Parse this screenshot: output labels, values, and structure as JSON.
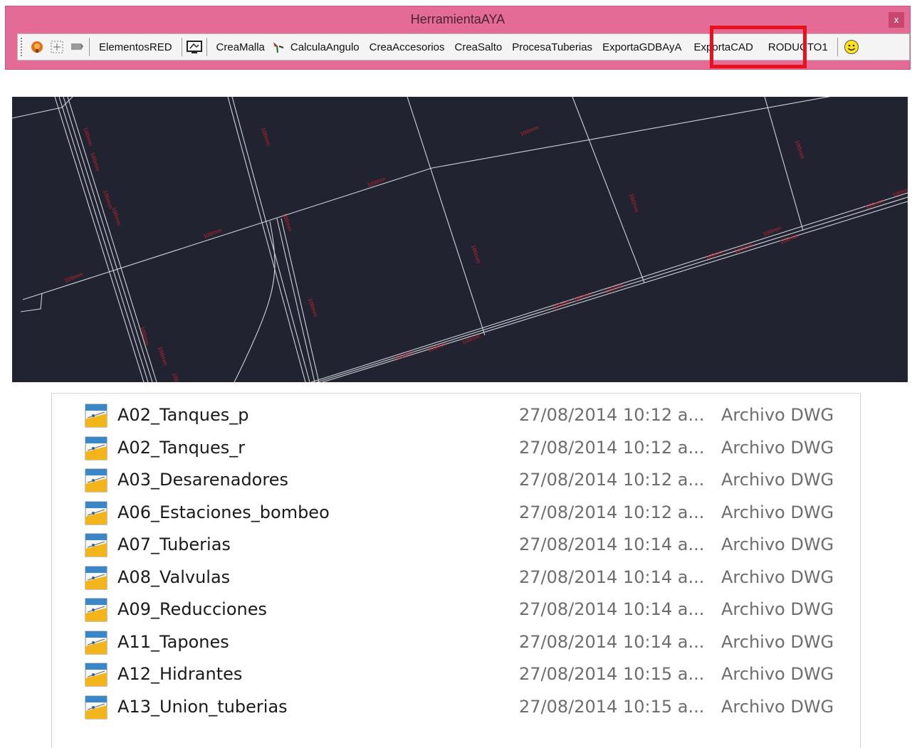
{
  "window": {
    "title": "HerramientaAYA",
    "close_label": "x"
  },
  "toolbar": {
    "items": [
      {
        "label": "ElementosRED"
      },
      {
        "label": "CreaMalla"
      },
      {
        "label": "CalculaAngulo"
      },
      {
        "label": "CreaAccesorios"
      },
      {
        "label": "CreaSalto"
      },
      {
        "label": "ProcesaTuberias"
      },
      {
        "label": "ExportaGDBAyA"
      },
      {
        "label": "ExportaCAD"
      },
      {
        "label": "RODUCTO1"
      }
    ],
    "highlighted": "ExportaCAD",
    "icons": [
      "orange-tool-icon",
      "select-grid-icon",
      "flag-icon",
      "layer-monitor-icon",
      "valve-arrow-icon",
      "smiley-icon"
    ]
  },
  "cad": {
    "labels": [
      "100mm",
      "100mm",
      "100mm",
      "100mm",
      "100mm",
      "100mm",
      "100mm",
      "100mm",
      "100mm",
      "100mm",
      "100mm",
      "100mm",
      "100mm",
      "100mm",
      "100mm",
      "100mm",
      "100mm",
      "100mm",
      "100mm",
      "100mm",
      "100mm",
      "100mm",
      "100mm",
      "100mm",
      "100mm",
      "100mm",
      "100mm",
      "100mm",
      "100mm"
    ]
  },
  "files": [
    {
      "name": "A02_Tanques_p",
      "date": "27/08/2014 10:12 a...",
      "type": "Archivo DWG"
    },
    {
      "name": "A02_Tanques_r",
      "date": "27/08/2014 10:12 a...",
      "type": "Archivo DWG"
    },
    {
      "name": "A03_Desarenadores",
      "date": "27/08/2014 10:12 a...",
      "type": "Archivo DWG"
    },
    {
      "name": "A06_Estaciones_bombeo",
      "date": "27/08/2014 10:12 a...",
      "type": "Archivo DWG"
    },
    {
      "name": "A07_Tuberias",
      "date": "27/08/2014 10:14 a...",
      "type": "Archivo DWG"
    },
    {
      "name": "A08_Valvulas",
      "date": "27/08/2014 10:14 a...",
      "type": "Archivo DWG"
    },
    {
      "name": "A09_Reducciones",
      "date": "27/08/2014 10:14 a...",
      "type": "Archivo DWG"
    },
    {
      "name": "A11_Tapones",
      "date": "27/08/2014 10:14 a...",
      "type": "Archivo DWG"
    },
    {
      "name": "A12_Hidrantes",
      "date": "27/08/2014 10:15 a...",
      "type": "Archivo DWG"
    },
    {
      "name": "A13_Union_tuberias",
      "date": "27/08/2014 10:15 a...",
      "type": "Archivo DWG"
    }
  ],
  "colors": {
    "titlebar": "#e36b96",
    "highlight": "#e8101c",
    "cad_background": "#212430",
    "cad_lines": "#cfd3d8",
    "cad_labels": "#d4202a"
  }
}
